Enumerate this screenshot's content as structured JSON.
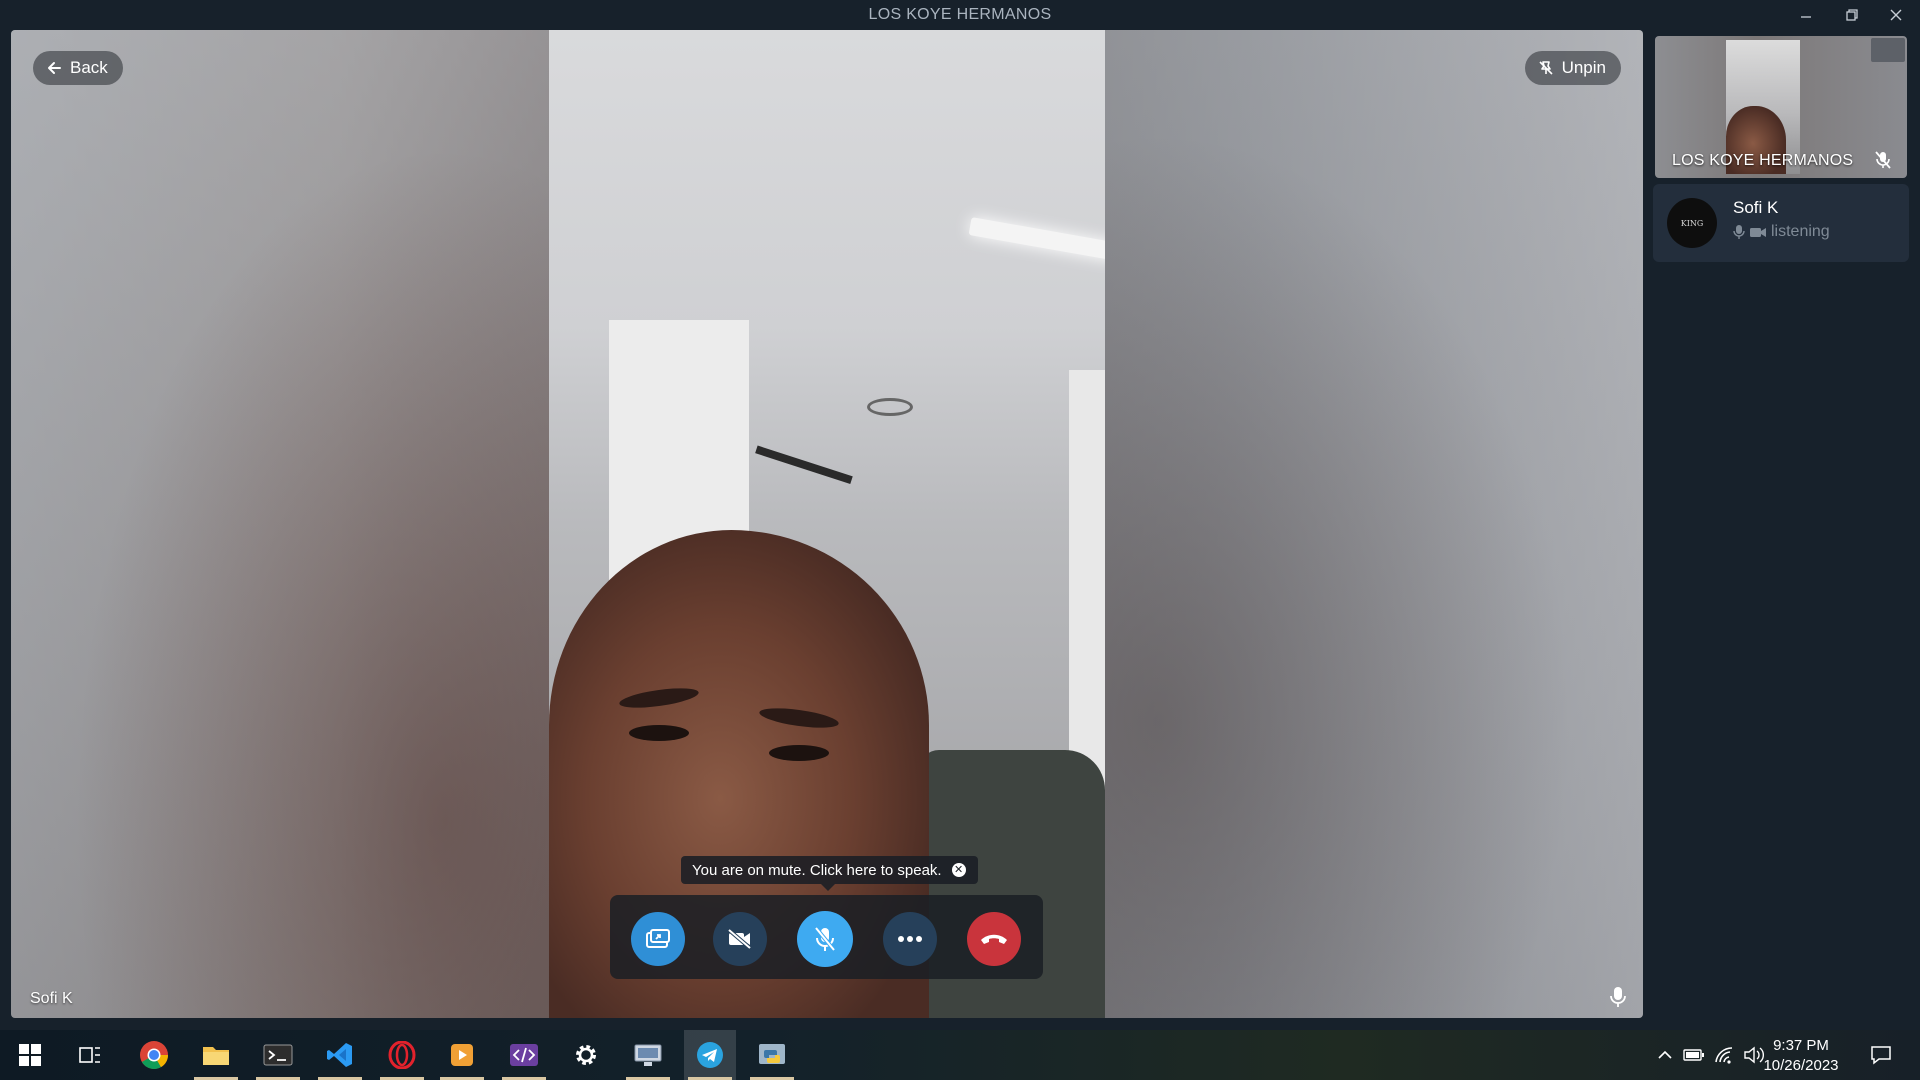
{
  "window": {
    "title": "LOS KOYE HERMANOS",
    "controls": [
      "minimize-icon",
      "restore-icon",
      "close-icon"
    ]
  },
  "call": {
    "back_label": "Back",
    "unpin_label": "Unpin",
    "speaker_name": "Sofi K",
    "mute_tooltip": "You are on mute. Click here to speak.",
    "buttons": {
      "screen_share": "screen-share-icon",
      "video_off": "video-off-icon",
      "mic_muted": "mic-muted-icon",
      "more": "more-icon",
      "end_call": "end-call-icon"
    },
    "colors": {
      "accent": "#2f8fd6",
      "mic_active": "#3eaaf1",
      "end_call": "#c9343c"
    }
  },
  "sidebar": {
    "thumbnail_name": "LOS KOYE HERMANOS",
    "participant": {
      "name": "Sofi K",
      "status": "listening",
      "avatar_text": "KING"
    }
  },
  "taskbar": {
    "apps": [
      "start",
      "task-view",
      "chrome",
      "file-explorer",
      "terminal",
      "vscode",
      "opera",
      "media-player",
      "dev-tool",
      "settings",
      "remote-desktop",
      "telegram",
      "python"
    ],
    "time": "9:37 PM",
    "date": "10/26/2023"
  }
}
